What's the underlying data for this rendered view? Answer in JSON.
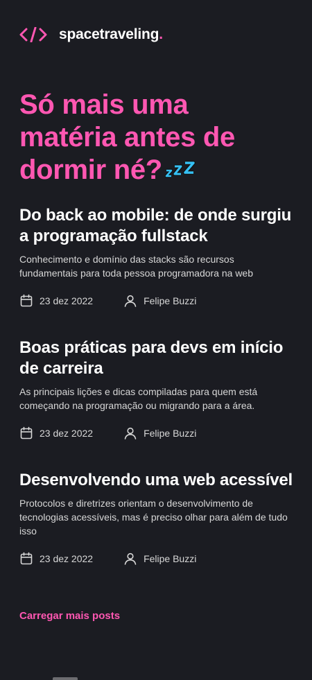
{
  "header": {
    "logo_icon": "code-brackets-icon",
    "logo_text": "spacetraveling",
    "logo_dot": ".",
    "brand_color": "#ff57b2"
  },
  "hero": {
    "title": "Só mais uma matéria antes de dormir né?",
    "emoji": "zzz-sleep-icon"
  },
  "posts": [
    {
      "title": "Do back ao mobile: de onde surgiu a programação fullstack",
      "subtitle": "Conhecimento e domínio das stacks são recursos fundamentais para toda pessoa programadora na web",
      "date": "23 dez 2022",
      "author": "Felipe Buzzi"
    },
    {
      "title": "Boas práticas para devs em início de carreira",
      "subtitle": "As principais lições e dicas compiladas para quem está começando na programação ou migrando para a área.",
      "date": "23 dez 2022",
      "author": "Felipe Buzzi"
    },
    {
      "title": "Desenvolvendo uma web acessível",
      "subtitle": "Protocolos e diretrizes orientam o desenvolvimento de tecnologias acessíveis, mas é preciso olhar para além de tudo isso",
      "date": "23 dez 2022",
      "author": "Felipe Buzzi"
    }
  ],
  "load_more_label": "Carregar mais posts"
}
